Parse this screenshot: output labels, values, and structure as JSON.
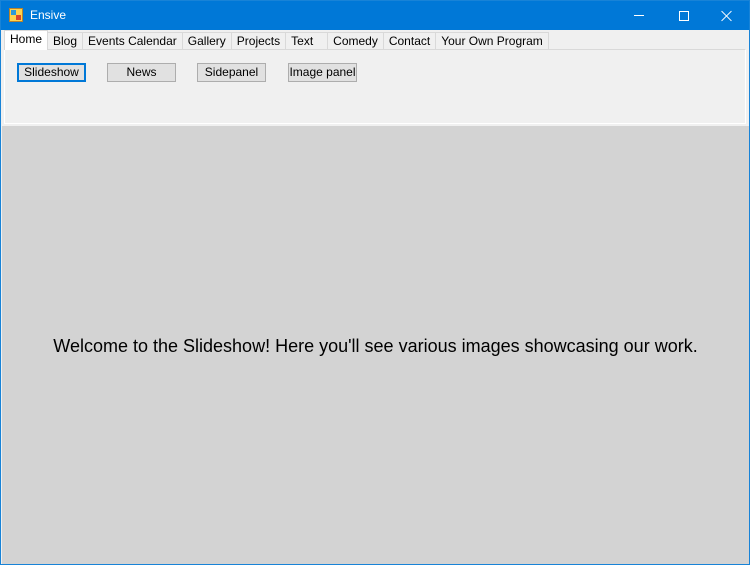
{
  "window": {
    "title": "Ensive"
  },
  "tabs": [
    {
      "label": "Home",
      "active": true
    },
    {
      "label": "Blog"
    },
    {
      "label": "Events Calendar"
    },
    {
      "label": "Gallery"
    },
    {
      "label": "Projects"
    },
    {
      "label": "Text"
    },
    {
      "label": "Comedy"
    },
    {
      "label": "Contact"
    },
    {
      "label": "Your Own Program"
    }
  ],
  "home_buttons": {
    "slideshow": "Slideshow",
    "news": "News",
    "sidepanel": "Sidepanel",
    "image_panel": "Image panel"
  },
  "content": {
    "message": "Welcome to the Slideshow! Here you'll see various images showcasing our work."
  },
  "colors": {
    "titlebar": "#0078d7",
    "content_background": "#d3d3d3"
  }
}
